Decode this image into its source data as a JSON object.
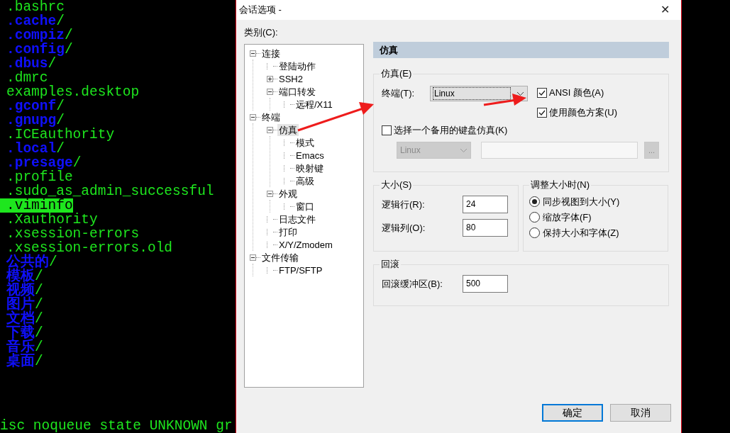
{
  "terminal": {
    "lines": [
      {
        "name": ".bashrc",
        "kind": "file",
        "highlighted": false
      },
      {
        "name": ".cache",
        "suffix": "/",
        "kind": "dir",
        "highlighted": false
      },
      {
        "name": ".compiz",
        "suffix": "/",
        "kind": "dir",
        "highlighted": false
      },
      {
        "name": ".config",
        "suffix": "/",
        "kind": "dir",
        "highlighted": false
      },
      {
        "name": ".dbus",
        "suffix": "/",
        "kind": "dir",
        "highlighted": false
      },
      {
        "name": ".dmrc",
        "kind": "file",
        "highlighted": false
      },
      {
        "name": "examples.desktop",
        "kind": "file",
        "highlighted": false
      },
      {
        "name": ".gconf",
        "suffix": "/",
        "kind": "dir",
        "highlighted": false
      },
      {
        "name": ".gnupg",
        "suffix": "/",
        "kind": "dir",
        "highlighted": false
      },
      {
        "name": ".ICEauthority",
        "kind": "file",
        "highlighted": false
      },
      {
        "name": ".local",
        "suffix": "/",
        "kind": "dir",
        "highlighted": false
      },
      {
        "name": ".presage",
        "suffix": "/",
        "kind": "dir",
        "highlighted": false
      },
      {
        "name": ".profile",
        "kind": "file",
        "highlighted": false
      },
      {
        "name": ".sudo_as_admin_successful",
        "kind": "file",
        "highlighted": false
      },
      {
        "name": ".viminfo",
        "kind": "file",
        "highlighted": true
      },
      {
        "name": ".Xauthority",
        "kind": "file",
        "highlighted": false
      },
      {
        "name": ".xsession-errors",
        "kind": "file",
        "highlighted": false
      },
      {
        "name": ".xsession-errors.old",
        "kind": "file",
        "highlighted": false
      },
      {
        "name": "公共的",
        "suffix": "/",
        "kind": "dir",
        "highlighted": false
      },
      {
        "name": "模板",
        "suffix": "/",
        "kind": "dir",
        "highlighted": false
      },
      {
        "name": "视频",
        "suffix": "/",
        "kind": "dir",
        "highlighted": false
      },
      {
        "name": "图片",
        "suffix": "/",
        "kind": "dir",
        "highlighted": false
      },
      {
        "name": "文档",
        "suffix": "/",
        "kind": "dir",
        "highlighted": false
      },
      {
        "name": "下载",
        "suffix": "/",
        "kind": "dir",
        "highlighted": false
      },
      {
        "name": "音乐",
        "suffix": "/",
        "kind": "dir",
        "highlighted": false
      },
      {
        "name": "桌面",
        "suffix": "/",
        "kind": "dir",
        "highlighted": false
      }
    ],
    "bottom_line": "isc noqueue state UNKNOWN gr"
  },
  "dialog": {
    "title": "会话选项 -",
    "close": "✕",
    "category_label": "类别(C):",
    "tree": [
      {
        "label": "连接",
        "expanded": true,
        "selected": false,
        "children": [
          {
            "label": "登陆动作",
            "selected": false
          },
          {
            "label": "SSH2",
            "expanded": false,
            "selected": false
          },
          {
            "label": "端口转发",
            "expanded": true,
            "selected": false,
            "children": [
              {
                "label": "远程/X11",
                "selected": false
              }
            ]
          }
        ]
      },
      {
        "label": "终端",
        "expanded": true,
        "selected": false,
        "children": [
          {
            "label": "仿真",
            "expanded": true,
            "selected": true,
            "children": [
              {
                "label": "模式",
                "selected": false
              },
              {
                "label": "Emacs",
                "selected": false
              },
              {
                "label": "映射键",
                "selected": false
              },
              {
                "label": "高级",
                "selected": false
              }
            ]
          },
          {
            "label": "外观",
            "expanded": true,
            "selected": false,
            "children": [
              {
                "label": "窗口",
                "selected": false
              }
            ]
          },
          {
            "label": "日志文件",
            "selected": false
          },
          {
            "label": "打印",
            "selected": false
          },
          {
            "label": "X/Y/Zmodem",
            "selected": false
          }
        ]
      },
      {
        "label": "文件传输",
        "expanded": true,
        "selected": false,
        "children": [
          {
            "label": "FTP/SFTP",
            "selected": false
          }
        ]
      }
    ],
    "section_title": "仿真",
    "emulation": {
      "legend": "仿真(E)",
      "terminal_label": "终端(T):",
      "terminal_value": "Linux",
      "checkboxes": [
        {
          "label": "ANSI 颜色(A)",
          "checked": true
        },
        {
          "label": "使用颜色方案(U)",
          "checked": true
        }
      ],
      "alt_keyboard": {
        "label": "选择一个备用的键盘仿真(K)",
        "checked": false
      },
      "alt_select": {
        "value": "Linux",
        "disabled": true
      },
      "browse_button": {
        "label": "...",
        "disabled": true
      }
    },
    "size": {
      "legend": "大小(S)",
      "fields": [
        {
          "label": "逻辑行(R):",
          "value": "24"
        },
        {
          "label": "逻辑列(O):",
          "value": "80"
        }
      ]
    },
    "resize": {
      "legend": "调整大小时(N)",
      "options": [
        {
          "label": "同步视图到大小(Y)",
          "selected": true
        },
        {
          "label": "缩放字体(F)",
          "selected": false
        },
        {
          "label": "保持大小和字体(Z)",
          "selected": false
        }
      ]
    },
    "scrollback": {
      "legend": "回滚",
      "label": "回滚缓冲区(B):",
      "value": "500"
    },
    "buttons": [
      {
        "label": "确定",
        "default": true
      },
      {
        "label": "取消",
        "default": false
      }
    ]
  }
}
